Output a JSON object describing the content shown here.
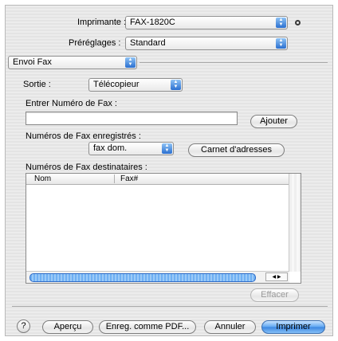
{
  "header": {
    "printer_label": "Imprimante :",
    "printer_value": "FAX-1820C",
    "presets_label": "Préréglages :",
    "presets_value": "Standard"
  },
  "section_popup": {
    "value": "Envoi Fax"
  },
  "output": {
    "label": "Sortie :",
    "value": "Télécopieur"
  },
  "fax_entry": {
    "label": "Entrer Numéro de Fax :",
    "value": "",
    "add_button": "Ajouter"
  },
  "saved_numbers": {
    "label": "Numéros de Fax enregistrés :",
    "value": "fax dom.",
    "address_book_button": "Carnet d'adresses"
  },
  "recipients": {
    "label": "Numéros de Fax destinataires :",
    "columns": [
      "Nom",
      "Fax#"
    ],
    "rows": [],
    "delete_button": "Effacer"
  },
  "footer": {
    "help_symbol": "?",
    "preview_button": "Aperçu",
    "save_pdf_button": "Enreg. comme PDF...",
    "cancel_button": "Annuler",
    "print_button": "Imprimer"
  },
  "colors": {
    "accent": "#3a85e0",
    "window_bg": "#ececec"
  }
}
